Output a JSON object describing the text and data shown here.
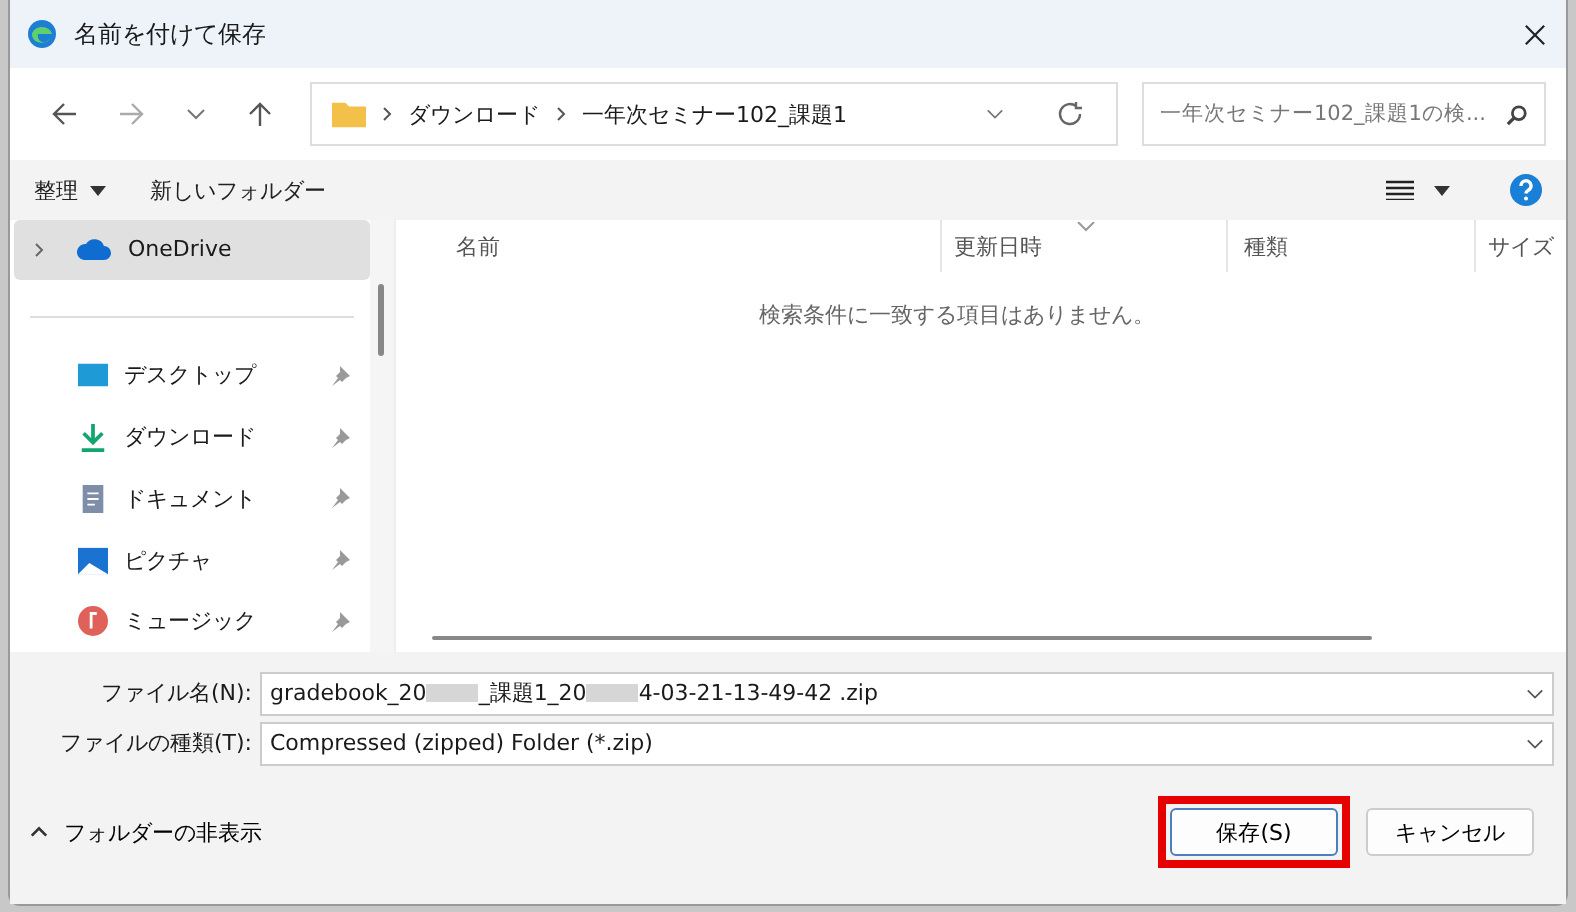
{
  "window": {
    "title": "名前を付けて保存"
  },
  "address": {
    "crumbs": [
      "ダウンロード",
      "一年次セミナー102_課題1"
    ]
  },
  "search": {
    "placeholder": "一年次セミナー102_課題1の検..."
  },
  "toolbar": {
    "organize": "整理",
    "new_folder": "新しいフォルダー"
  },
  "sidebar": {
    "top": {
      "label": "OneDrive",
      "selected": true
    },
    "items": [
      {
        "label": "デスクトップ",
        "kind": "desktop"
      },
      {
        "label": "ダウンロード",
        "kind": "download"
      },
      {
        "label": "ドキュメント",
        "kind": "document"
      },
      {
        "label": "ピクチャ",
        "kind": "picture"
      },
      {
        "label": "ミュージック",
        "kind": "music"
      }
    ]
  },
  "table": {
    "columns": [
      "名前",
      "更新日時",
      "種類",
      "サイズ"
    ],
    "empty_message": "検索条件に一致する項目はありません。"
  },
  "file_name": {
    "label": "ファイル名(N):",
    "value_parts": [
      "gradebook_20",
      "_課題1_20",
      "4-03-21-13-49-42 .zip"
    ]
  },
  "file_type": {
    "label": "ファイルの種類(T):",
    "value": "Compressed (zipped) Folder (*.zip)"
  },
  "hide_folders": "フォルダーの非表示",
  "buttons": {
    "save": "保存(S)",
    "cancel": "キャンセル"
  }
}
